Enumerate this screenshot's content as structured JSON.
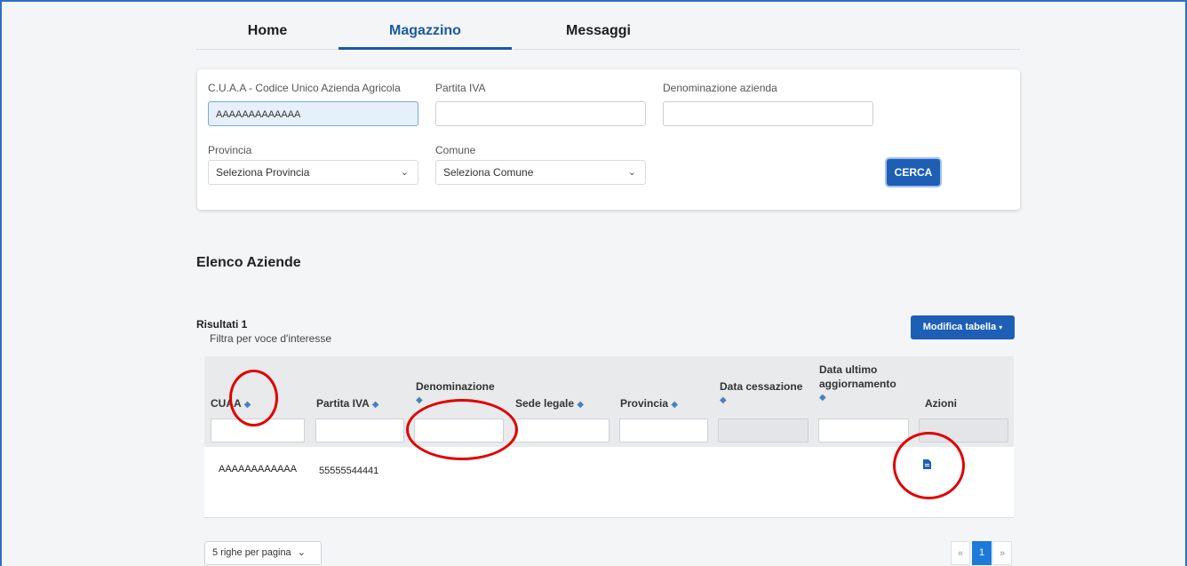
{
  "tabs": [
    {
      "label": "Home"
    },
    {
      "label": "Magazzino"
    },
    {
      "label": "Messaggi"
    }
  ],
  "filters": {
    "cuaa_label": "C.U.A.A - Codice Unico Azienda Agricola",
    "cuaa_value": "AAAAAAAAAAAAA",
    "piva_label": "Partita IVA",
    "piva_value": "",
    "denom_label": "Denominazione azienda",
    "denom_value": "",
    "provincia_label": "Provincia",
    "provincia_selected": "Seleziona Provincia",
    "comune_label": "Comune",
    "comune_selected": "Seleziona Comune",
    "search_label": "CERCA"
  },
  "section_title": "Elenco Aziende",
  "results_label": "Risultati 1",
  "filter_hint": "Filtra per voce d'interesse",
  "edit_table_label": "Modifica tabella",
  "table": {
    "headers": {
      "cuaa": "CUAA",
      "piva": "Partita IVA",
      "denominazione": "Denominazione",
      "sede": "Sede legale",
      "provincia": "Provincia",
      "cessazione": "Data cessazione",
      "aggiornamento_1": "Data ultimo",
      "aggiornamento_2": "aggiornamento",
      "azioni": "Azioni"
    },
    "rows": [
      {
        "cuaa": "AAAAAAAAAAAA",
        "piva": "55555544441"
      }
    ]
  },
  "pagination": {
    "per_page": "5 righe per pagina",
    "prev": "«",
    "current": "1",
    "next": "»"
  },
  "colors": {
    "accent": "#1d5fb4",
    "annotation": "#e10000"
  }
}
